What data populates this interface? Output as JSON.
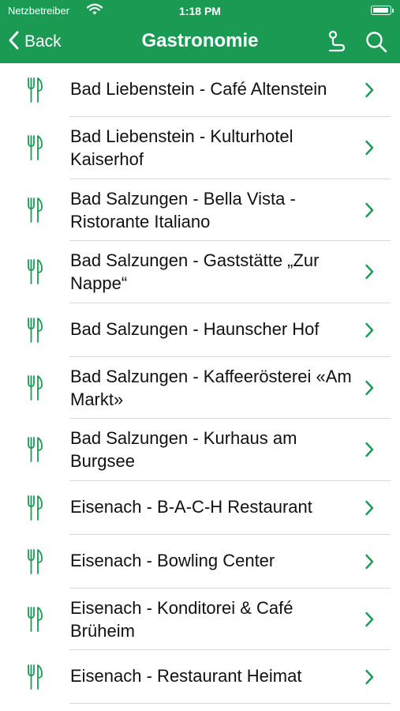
{
  "status_bar": {
    "carrier": "Netzbetreiber",
    "time": "1:18 PM"
  },
  "nav": {
    "back_label": "Back",
    "title": "Gastronomie"
  },
  "colors": {
    "accent": "#1a9a52",
    "separator": "#d9d9d9"
  },
  "icons": {
    "row": "fork-knife-icon",
    "chevron": "chevron-right-icon"
  },
  "items": [
    {
      "label": "Bad Liebenstein - Café Altenstein"
    },
    {
      "label": "Bad Liebenstein - Kulturhotel Kaiserhof"
    },
    {
      "label": "Bad Salzungen - Bella Vista - Ristorante Italiano"
    },
    {
      "label": "Bad Salzungen - Gaststätte „Zur Nappe“"
    },
    {
      "label": "Bad Salzungen - Haunscher Hof"
    },
    {
      "label": "Bad Salzungen - Kaffeerösterei «Am Markt»"
    },
    {
      "label": "Bad Salzungen - Kurhaus am Burgsee"
    },
    {
      "label": "Eisenach - B-A-C-H Restaurant"
    },
    {
      "label": "Eisenach - Bowling Center"
    },
    {
      "label": "Eisenach - Konditorei & Café Brüheim"
    },
    {
      "label": "Eisenach - Restaurant Heimat"
    }
  ]
}
